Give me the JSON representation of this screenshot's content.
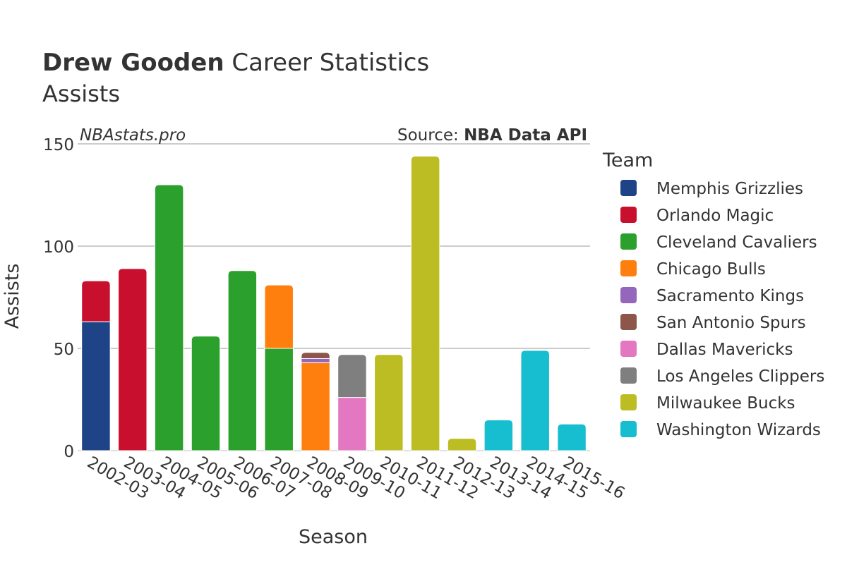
{
  "header": {
    "title_bold": "Drew Gooden",
    "title_rest": " Career Statistics",
    "subtitle": "Assists",
    "watermark": "NBAstats.pro",
    "source_prefix": "Source: ",
    "source_bold": "NBA Data API"
  },
  "legend": {
    "title": "Team"
  },
  "chart_data": {
    "type": "bar",
    "stacked": true,
    "title": "Drew Gooden Career Statistics",
    "subtitle": "Assists",
    "xlabel": "Season",
    "ylabel": "Assists",
    "ylim": [
      0,
      150
    ],
    "yticks": [
      0,
      50,
      100,
      150
    ],
    "grid": true,
    "legend_position": "right",
    "categories": [
      "2002-03",
      "2003-04",
      "2004-05",
      "2005-06",
      "2006-07",
      "2007-08",
      "2008-09",
      "2009-10",
      "2010-11",
      "2011-12",
      "2012-13",
      "2013-14",
      "2014-15",
      "2015-16"
    ],
    "series": [
      {
        "name": "Memphis Grizzlies",
        "color": "#1f4387",
        "values": [
          63,
          0,
          0,
          0,
          0,
          0,
          0,
          0,
          0,
          0,
          0,
          0,
          0,
          0
        ]
      },
      {
        "name": "Orlando Magic",
        "color": "#c8102e",
        "values": [
          20,
          89,
          0,
          0,
          0,
          0,
          0,
          0,
          0,
          0,
          0,
          0,
          0,
          0
        ]
      },
      {
        "name": "Cleveland Cavaliers",
        "color": "#2ca02c",
        "values": [
          0,
          0,
          130,
          56,
          88,
          50,
          0,
          0,
          0,
          0,
          0,
          0,
          0,
          0
        ]
      },
      {
        "name": "Chicago Bulls",
        "color": "#ff7f0e",
        "values": [
          0,
          0,
          0,
          0,
          0,
          31,
          43,
          0,
          0,
          0,
          0,
          0,
          0,
          0
        ]
      },
      {
        "name": "Sacramento Kings",
        "color": "#9467bd",
        "values": [
          0,
          0,
          0,
          0,
          0,
          0,
          2,
          0,
          0,
          0,
          0,
          0,
          0,
          0
        ]
      },
      {
        "name": "San Antonio Spurs",
        "color": "#8c564b",
        "values": [
          0,
          0,
          0,
          0,
          0,
          0,
          3,
          0,
          0,
          0,
          0,
          0,
          0,
          0
        ]
      },
      {
        "name": "Dallas Mavericks",
        "color": "#e377c2",
        "values": [
          0,
          0,
          0,
          0,
          0,
          0,
          0,
          26,
          0,
          0,
          0,
          0,
          0,
          0
        ]
      },
      {
        "name": "Los Angeles Clippers",
        "color": "#7f7f7f",
        "values": [
          0,
          0,
          0,
          0,
          0,
          0,
          0,
          21,
          0,
          0,
          0,
          0,
          0,
          0
        ]
      },
      {
        "name": "Milwaukee Bucks",
        "color": "#bcbd22",
        "values": [
          0,
          0,
          0,
          0,
          0,
          0,
          0,
          0,
          47,
          144,
          6,
          0,
          0,
          0
        ]
      },
      {
        "name": "Washington Wizards",
        "color": "#17becf",
        "values": [
          0,
          0,
          0,
          0,
          0,
          0,
          0,
          0,
          0,
          0,
          0,
          15,
          49,
          13
        ]
      }
    ]
  }
}
